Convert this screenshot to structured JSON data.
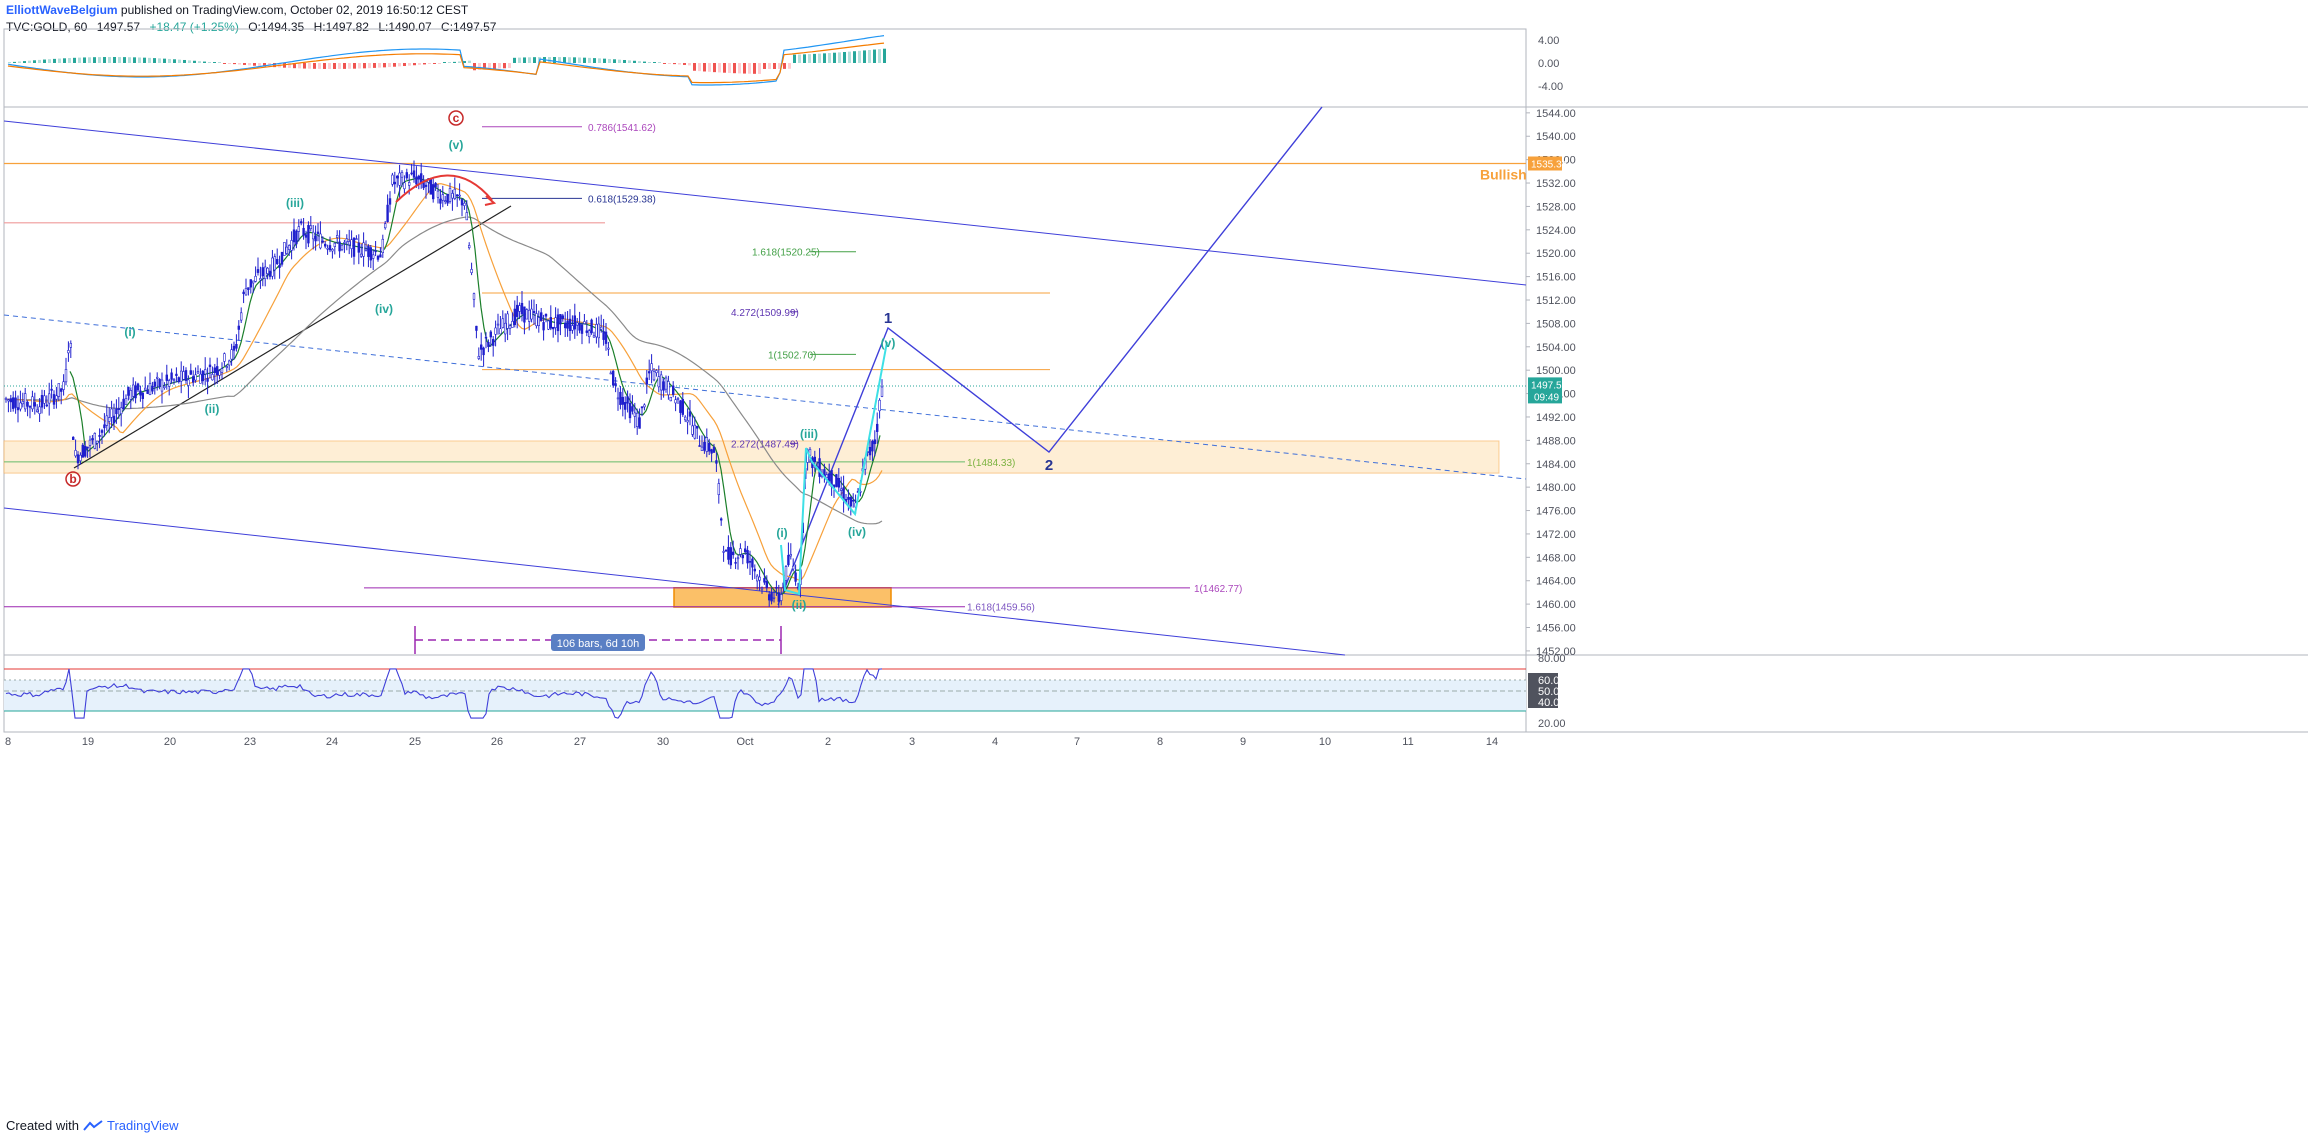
{
  "header": {
    "author": "ElliottWaveBelgium",
    "published": "published on TradingView.com, October 02, 2019 16:50:12 CEST",
    "symbol": "TVC:GOLD, 60",
    "last": "1497.57",
    "change": "+18.47 (+1.25%)",
    "open": "O:1494.35",
    "high": "H:1497.82",
    "low": "L:1490.07",
    "close": "C:1497.57"
  },
  "footer": {
    "created": "Created with",
    "brand": "TradingView"
  },
  "colors": {
    "candle": "#1e1ecd",
    "wave_teal": "#26a69a",
    "wave_cyan": "#40e0e0",
    "fib_purple": "#9c27b0",
    "fib_green": "#4caf50",
    "orange": "#f7a13b",
    "blue_line": "#3f3fd9",
    "red": "#e53935"
  },
  "chart_data": {
    "type": "candlestick",
    "price_axis": {
      "ticks": [
        "1544.00",
        "1540.00",
        "1536.00",
        "1532.00",
        "1528.00",
        "1524.00",
        "1520.00",
        "1516.00",
        "1512.00",
        "1508.00",
        "1504.00",
        "1500.00",
        "1496.00",
        "1492.00",
        "1488.00",
        "1484.00",
        "1480.00",
        "1476.00",
        "1472.00",
        "1468.00",
        "1464.00",
        "1460.00",
        "1456.00",
        "1452.00"
      ],
      "range": [
        1452,
        1545
      ]
    },
    "time_axis": {
      "ticks": [
        "8",
        "19",
        "20",
        "23",
        "24",
        "25",
        "26",
        "27",
        "30",
        "Oct",
        "2",
        "3",
        "4",
        "7",
        "8",
        "9",
        "10",
        "11",
        "14"
      ]
    },
    "price_labels": {
      "bullish_level": "1535.34",
      "last_price": "1497.57",
      "countdown": "09:49",
      "bullish_text": "Bullish"
    },
    "fib_levels": [
      {
        "label": "0.786(1541.62)",
        "price": 1541.62
      },
      {
        "label": "0.618(1529.38)",
        "price": 1529.38
      },
      {
        "label": "1.618(1520.25)",
        "price": 1520.25
      },
      {
        "label": "4.272(1509.99)",
        "price": 1509.99
      },
      {
        "label": "1(1502.70)",
        "price": 1502.7
      },
      {
        "label": "2.272(1487.49)",
        "price": 1487.49
      },
      {
        "label": "1(1484.33)",
        "price": 1484.33
      },
      {
        "label": "1(1462.77)",
        "price": 1462.77
      },
      {
        "label": "1.618(1459.56)",
        "price": 1459.56
      }
    ],
    "wave_labels": [
      "c",
      "(v)",
      "(iii)",
      "(iv)",
      "(i)",
      "(ii)",
      "b",
      "(iii)",
      "(i)",
      "(ii)",
      "(iv)",
      "(v)",
      "1",
      "2"
    ],
    "range_measure": "106 bars, 6d 10h",
    "macd_axis": [
      "4.00",
      "0.00",
      "-4.00"
    ],
    "rsi_axis": [
      "80.00",
      "60.00",
      "50.00",
      "40.00",
      "20.00"
    ]
  }
}
